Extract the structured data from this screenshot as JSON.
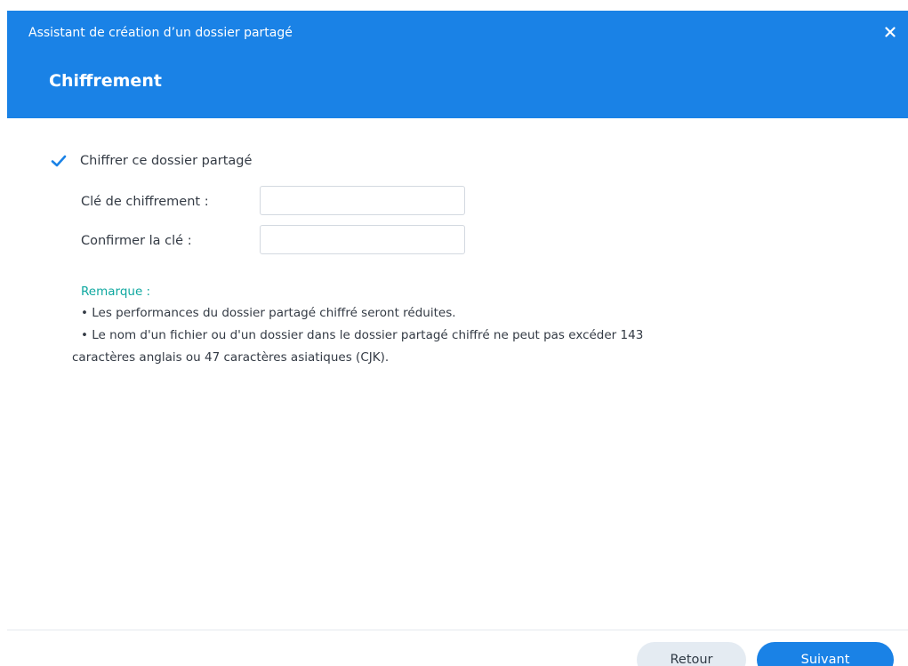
{
  "header": {
    "window_title": "Assistant de création d’un dossier partagé",
    "step_title": "Chiffrement",
    "close_icon": "close-icon"
  },
  "form": {
    "encrypt_checkbox": {
      "label": "Chiffrer ce dossier partagé",
      "checked": true,
      "icon": "checkmark-icon"
    },
    "fields": [
      {
        "label": "Clé de chiffrement :",
        "value": "",
        "placeholder": ""
      },
      {
        "label": "Confirmer la clé :",
        "value": "",
        "placeholder": ""
      }
    ]
  },
  "note": {
    "title": "Remarque :",
    "items": [
      "• Les performances du dossier partagé chiffré seront réduites.",
      "• Le nom d'un fichier ou d'un dossier dans le dossier partagé chiffré ne peut pas excéder 143",
      "caractères anglais ou 47 caractères asiatiques (CJK)."
    ]
  },
  "footer": {
    "back_label": "Retour",
    "next_label": "Suivant"
  },
  "colors": {
    "accent": "#1a82e6",
    "note_title": "#0fa8a0",
    "text": "#333a44",
    "back_button_bg": "#e4ebf2"
  }
}
